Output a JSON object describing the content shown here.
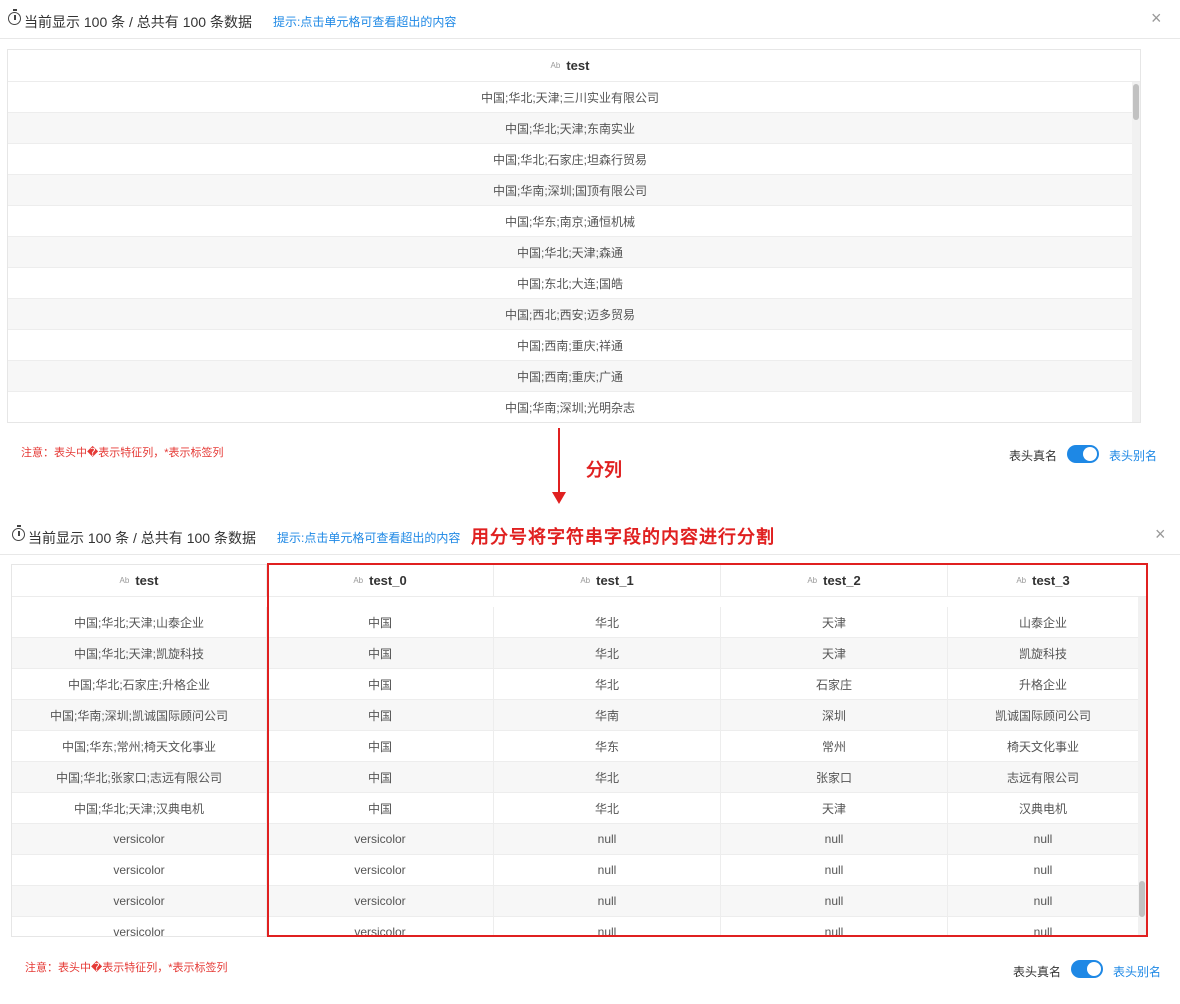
{
  "top": {
    "count_text": "当前显示 100 条 / 总共有 100 条数据",
    "hint": "提示:点击单元格可查看超出的内容",
    "close": "×",
    "header": {
      "type_icon": "Ab",
      "label": "test"
    },
    "rows": [
      "中国;华北;天津;三川实业有限公司",
      "中国;华北;天津;东南实业",
      "中国;华北;石家庄;坦森行贸易",
      "中国;华南;深圳;国顶有限公司",
      "中国;华东;南京;通恒机械",
      "中国;华北;天津;森通",
      "中国;东北;大连;国皓",
      "中国;西北;西安;迈多贸易",
      "中国;西南;重庆;祥通",
      "中国;西南;重庆;广通",
      "中国;华南;深圳;光明杂志"
    ],
    "note": "注意：表头中�表示特征列，*表示标签列",
    "toggle_label": "表头真名",
    "toggle_alias": "表头别名"
  },
  "arrow": {
    "label": "分列"
  },
  "annotation": "用分号将字符串字段的内容进行分割",
  "bottom": {
    "count_text": "当前显示 100 条 / 总共有 100 条数据",
    "hint": "提示:点击单元格可查看超出的内容",
    "close": "×",
    "headers": [
      {
        "type_icon": "Ab",
        "label": "test"
      },
      {
        "type_icon": "Ab",
        "label": "test_0"
      },
      {
        "type_icon": "Ab",
        "label": "test_1"
      },
      {
        "type_icon": "Ab",
        "label": "test_2"
      },
      {
        "type_icon": "Ab",
        "label": "test_3"
      }
    ],
    "rows": [
      [
        "中国;华北;天津;山泰企业",
        "中国",
        "华北",
        "天津",
        "山泰企业"
      ],
      [
        "中国;华北;天津;凯旋科技",
        "中国",
        "华北",
        "天津",
        "凯旋科技"
      ],
      [
        "中国;华北;石家庄;升格企业",
        "中国",
        "华北",
        "石家庄",
        "升格企业"
      ],
      [
        "中国;华南;深圳;凯诚国际顾问公司",
        "中国",
        "华南",
        "深圳",
        "凯诚国际顾问公司"
      ],
      [
        "中国;华东;常州;椅天文化事业",
        "中国",
        "华东",
        "常州",
        "椅天文化事业"
      ],
      [
        "中国;华北;张家口;志远有限公司",
        "中国",
        "华北",
        "张家口",
        "志远有限公司"
      ],
      [
        "中国;华北;天津;汉典电机",
        "中国",
        "华北",
        "天津",
        "汉典电机"
      ],
      [
        "versicolor",
        "versicolor",
        "null",
        "null",
        "null"
      ],
      [
        "versicolor",
        "versicolor",
        "null",
        "null",
        "null"
      ],
      [
        "versicolor",
        "versicolor",
        "null",
        "null",
        "null"
      ],
      [
        "versicolor",
        "versicolor",
        "null",
        "null",
        "null"
      ]
    ],
    "note": "注意：表头中�表示特征列，*表示标签列",
    "toggle_label": "表头真名",
    "toggle_alias": "表头别名"
  }
}
